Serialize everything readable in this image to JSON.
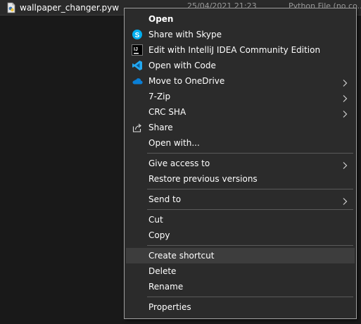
{
  "file": {
    "name": "wallpaper_changer.pyw",
    "date": "25/04/2021 21:23",
    "type": "Python File (no co..."
  },
  "menu": {
    "open": "Open",
    "share_skype": "Share with Skype",
    "edit_intellij": "Edit with IntelliJ IDEA Community Edition",
    "open_code": "Open with Code",
    "move_onedrive": "Move to OneDrive",
    "seven_zip": "7-Zip",
    "crc_sha": "CRC SHA",
    "share": "Share",
    "open_with": "Open with...",
    "give_access": "Give access to",
    "restore_versions": "Restore previous versions",
    "send_to": "Send to",
    "cut": "Cut",
    "copy": "Copy",
    "create_shortcut": "Create shortcut",
    "delete": "Delete",
    "rename": "Rename",
    "properties": "Properties"
  },
  "icons": {
    "intellij_text": "IJ"
  },
  "colors": {
    "menu_bg": "#2b2b2b",
    "highlight": "#3d3d3d",
    "skype": "#00aff0",
    "vscode": "#23a9f2",
    "onedrive": "#0a7fd6"
  }
}
